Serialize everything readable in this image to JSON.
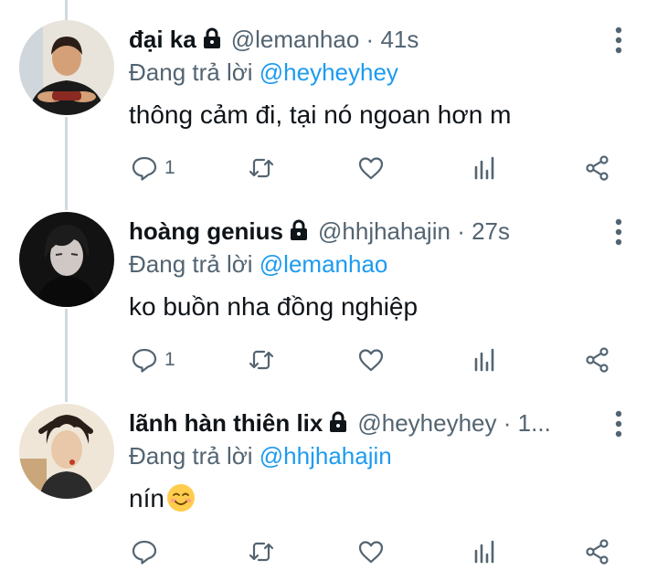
{
  "tweets": [
    {
      "name": "đại ka",
      "handle": "@lemanhao",
      "separator": "·",
      "time": "41s",
      "reply_prefix": "Đang trả lời ",
      "reply_mention": "@heyheyhey",
      "text": "thông cảm đi, tại nó ngoan hơn m",
      "reply_count": "1",
      "avatar_colors": {
        "bg": "#e8e4dc",
        "skin": "#d4a078",
        "shirt": "#1a1a1a",
        "hair": "#2a1e16"
      }
    },
    {
      "name": "hoàng genius",
      "handle": "@hhjhahajin",
      "separator": "·",
      "time": "27s",
      "reply_prefix": "Đang trả lời ",
      "reply_mention": "@lemanhao",
      "text": "ko buồn nha đồng nghiệp",
      "reply_count": "1",
      "avatar_colors": {
        "bg": "#121212",
        "skin": "#cfc8c4",
        "shirt": "#0a0a0a",
        "hair": "#1c1c1c"
      }
    },
    {
      "name": "lãnh hàn thiên lix",
      "handle": "@heyheyhey",
      "separator": "·",
      "time": "1...",
      "reply_prefix": "Đang trả lời ",
      "reply_mention": "@hhjhahajin",
      "text": "nín",
      "emoji": "smiling-face-emoji",
      "reply_count": "",
      "avatar_colors": {
        "bg": "#efe6d8",
        "skin": "#e8c8a8",
        "shirt": "#2b2b2b",
        "hair": "#2a1f18"
      }
    }
  ],
  "icons": {
    "lock": "lock-icon",
    "more": "more-vertical-icon",
    "reply": "reply-icon",
    "retweet": "retweet-icon",
    "like": "heart-icon",
    "analytics": "analytics-icon",
    "share": "share-icon"
  },
  "colors": {
    "mention": "#1d9bf0",
    "secondary": "#536471",
    "text": "#0f1419",
    "thread_line": "#cfd9de"
  }
}
